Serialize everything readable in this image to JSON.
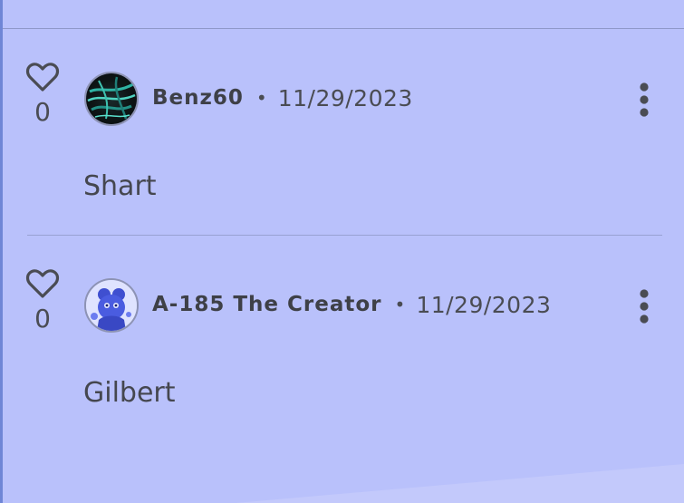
{
  "comments": [
    {
      "username": "Benz60",
      "separator": "•",
      "date": "11/29/2023",
      "body": "Shart",
      "likes": "0",
      "avatar_icon": "avatar-dark-teal-swirl",
      "like_icon": "heart-outline-icon",
      "menu_icon": "more-vertical-icon"
    },
    {
      "username": "A-185 The Creator",
      "separator": "•",
      "date": "11/29/2023",
      "body": "Gilbert",
      "likes": "0",
      "avatar_icon": "avatar-blue-character",
      "like_icon": "heart-outline-icon",
      "menu_icon": "more-vertical-icon"
    }
  ],
  "colors": {
    "background": "#b9c1fb",
    "text": "#45474f",
    "divider": "#98a1d2",
    "accent_edge": "#6f86d6"
  }
}
